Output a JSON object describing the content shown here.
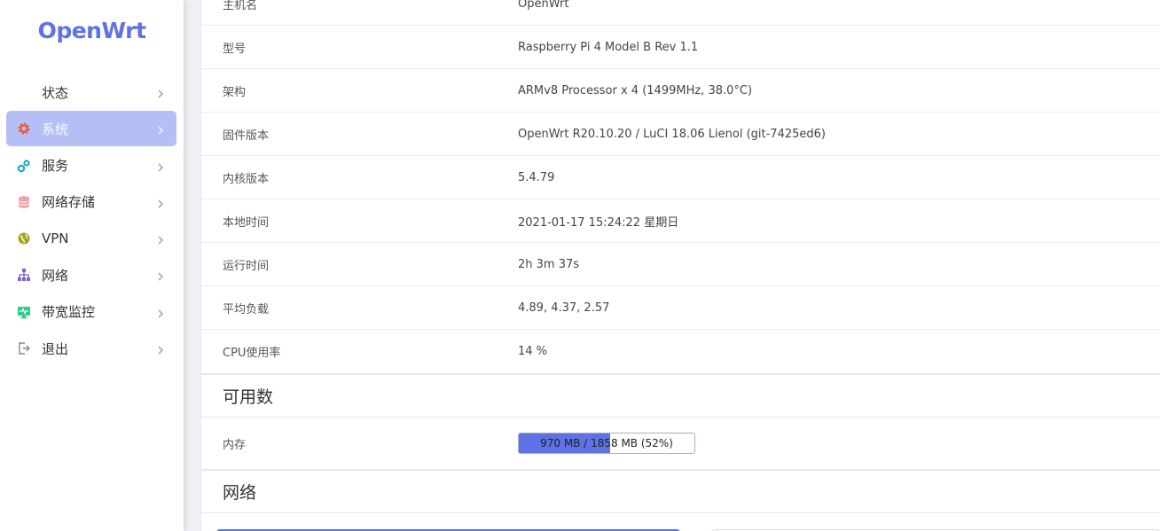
{
  "brand": "OpenWrt",
  "colors": {
    "accent": "#5e72e4",
    "active_bg": "#b6bff5"
  },
  "sidebar": {
    "items": [
      {
        "label": "状态",
        "icon": "none"
      },
      {
        "label": "系统",
        "icon": "gear-icon",
        "active": true
      },
      {
        "label": "服务",
        "icon": "cogs-icon"
      },
      {
        "label": "网络存储",
        "icon": "database-icon"
      },
      {
        "label": "VPN",
        "icon": "globe-icon"
      },
      {
        "label": "网络",
        "icon": "sitemap-icon"
      },
      {
        "label": "带宽监控",
        "icon": "monitor-icon"
      },
      {
        "label": "退出",
        "icon": "logout-icon"
      }
    ]
  },
  "system": {
    "rows": [
      {
        "key": "主机名",
        "value": "OpenWrt"
      },
      {
        "key": "型号",
        "value": "Raspberry Pi 4 Model B Rev 1.1"
      },
      {
        "key": "架构",
        "value": "ARMv8 Processor x 4 (1499MHz, 38.0°C)"
      },
      {
        "key": "固件版本",
        "value": "OpenWrt R20.10.20 / LuCI 18.06 Lienol (git-7425ed6)"
      },
      {
        "key": "内核版本",
        "value": "5.4.79"
      },
      {
        "key": "本地时间",
        "value": "2021-01-17 15:24:22 星期日"
      },
      {
        "key": "运行时间",
        "value": "2h 3m 37s"
      },
      {
        "key": "平均负载",
        "value": "4.89, 4.37, 2.57"
      },
      {
        "key": "CPU使用率",
        "value": "14 %"
      }
    ]
  },
  "available": {
    "title": "可用数",
    "memory": {
      "key": "内存",
      "text": "970 MB / 1858 MB (52%)",
      "percent": 52
    }
  },
  "network": {
    "title": "网络"
  }
}
